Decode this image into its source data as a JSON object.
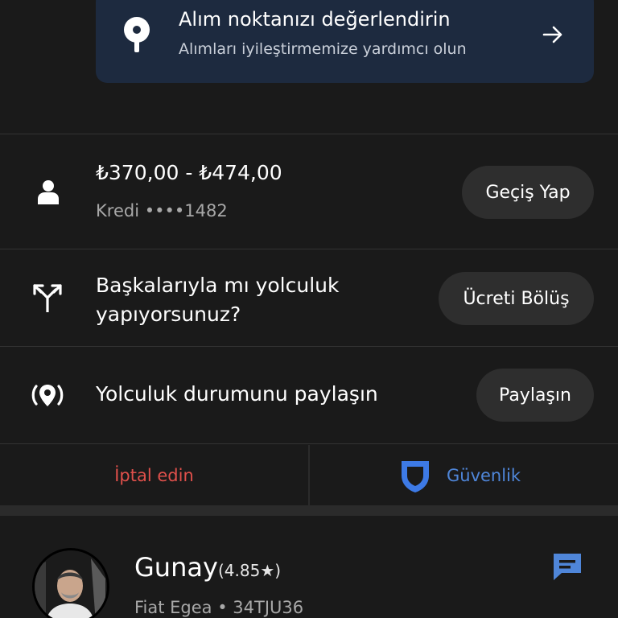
{
  "pickup_banner": {
    "title": "Alım noktanızı değerlendirin",
    "subtitle": "Alımları iyileştirmemize yardımcı olun",
    "icon": "location-pin-icon",
    "arrow_icon": "arrow-right-icon"
  },
  "fare": {
    "amount": "₺370,00 - ₺474,00",
    "payment_method": "Kredi ••••1482",
    "switch_label": "Geçiş Yap",
    "icon": "person-icon"
  },
  "split_fare": {
    "question": "Başkalarıyla mı yolculuk yapıyorsunuz?",
    "button_label": "Ücreti Bölüş",
    "icon": "split-arrows-icon"
  },
  "share_status": {
    "text": "Yolculuk durumunu paylaşın",
    "button_label": "Paylaşın",
    "icon": "broadcast-location-icon"
  },
  "actions": {
    "cancel_label": "İptal edin",
    "safety_label": "Güvenlik",
    "cancel_color": "#e0504b",
    "safety_color": "#4f86d9"
  },
  "driver": {
    "name": "Gunay",
    "rating": "(4.85★)",
    "car": "Fiat Egea • 34TJU36",
    "chat_icon": "chat-icon"
  },
  "colors": {
    "background": "#1a1a1a",
    "banner_bg": "#1d2a3f",
    "pill_bg": "#2e2e2e",
    "accent_blue": "#4f86d9"
  }
}
